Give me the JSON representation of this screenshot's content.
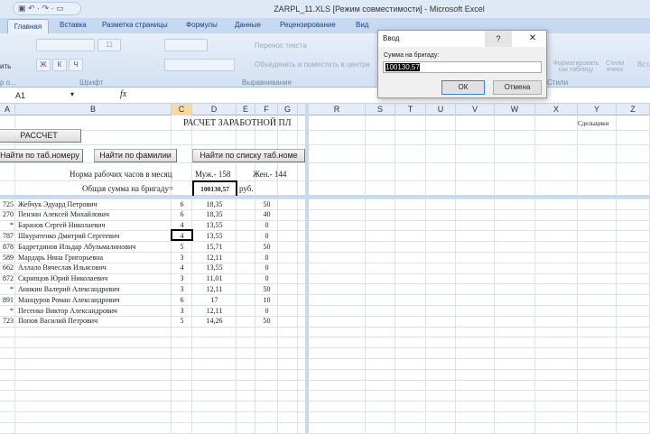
{
  "window": {
    "title": "ZARPL_11.XLS  [Режим совместимости] - Microsoft Excel",
    "qat": "▣ ↶ · ↷ · ▭"
  },
  "tabs": [
    "Главная",
    "Вставка",
    "Разметка страницы",
    "Формулы",
    "Данные",
    "Рецензирование",
    "Вид"
  ],
  "ribbon": {
    "paste": "ить",
    "clipboard_group": "р о...",
    "font_size": "11",
    "bold": "Ж",
    "italic": "К",
    "underline": "Ч",
    "font_group": "Шрифт",
    "wrap_text": "Перенос текста",
    "merge_center": "Объединить и поместить в центре",
    "align_group": "Выравнивание",
    "format_table": "Форматировать как таблицу",
    "cell_styles": "Стили ячеек",
    "styles_group": "Стили",
    "insert": "Вста"
  },
  "formula_bar": {
    "name_box": "A1",
    "fx": "fx",
    "value": ""
  },
  "columns": [
    "A",
    "B",
    "C",
    "D",
    "E",
    "F",
    "G",
    "R",
    "S",
    "T",
    "U",
    "V",
    "W",
    "X",
    "Y",
    "Z"
  ],
  "sheet": {
    "title": "РАСЧЕТ ЗАРАБОТНОЙ ПЛ",
    "btn_calc": "РАССЧЕТ",
    "btn_find_tab": "Найти по таб.номеру",
    "btn_find_name": "Найти по фамилии",
    "btn_find_list": "Найти по списку таб.номе",
    "norm_label": "Норма рабочих часов в месяц",
    "norm_male": "Муж.- 158",
    "norm_female": "Жен.- 144",
    "total_label": "Общая сумма  на бригаду=",
    "total_value": "100130,57",
    "currency": "руб.",
    "y_label": "Сдельщики",
    "rows": [
      [
        "725",
        "Жебчук Эдуард Петрович",
        "6",
        "18,35",
        "50"
      ],
      [
        "270",
        "Пензин Алексей Михайлович",
        "6",
        "18,35",
        "40"
      ],
      [
        "*",
        "Баранов Сергей Николаевич",
        "4",
        "13,55",
        "0"
      ],
      [
        "787",
        "Шкуратенко Дмитрий Сергеевич",
        "4",
        "13,55",
        "0"
      ],
      [
        "878",
        "Бадретдинов Ильдар Абульмалинович",
        "5",
        "15,71",
        "50"
      ],
      [
        "589",
        "Мардарь Нина Григорьевна",
        "3",
        "12,11",
        "0"
      ],
      [
        "662",
        "Аллало Вячеслав Ильясович",
        "4",
        "13,55",
        "0"
      ],
      [
        "872",
        "Скрипцов Юрий Николаевич",
        "3",
        "11,01",
        "0"
      ],
      [
        "*",
        "Аникин Валерий Александрович",
        "3",
        "12,11",
        "50"
      ],
      [
        "891",
        "Манцуров Роман Александрович",
        "6",
        "17",
        "10"
      ],
      [
        "*",
        "Песенко Виктор Александрович",
        "3",
        "12,11",
        "0"
      ],
      [
        "723",
        "Попов Василий Петрович",
        "5",
        "14,26",
        "50"
      ]
    ]
  },
  "dialog": {
    "title": "Ввод",
    "help": "?",
    "close": "✕",
    "prompt": "Сумма на бригаду:",
    "value": "100130,57",
    "ok": "ОК",
    "cancel": "Отмена"
  }
}
